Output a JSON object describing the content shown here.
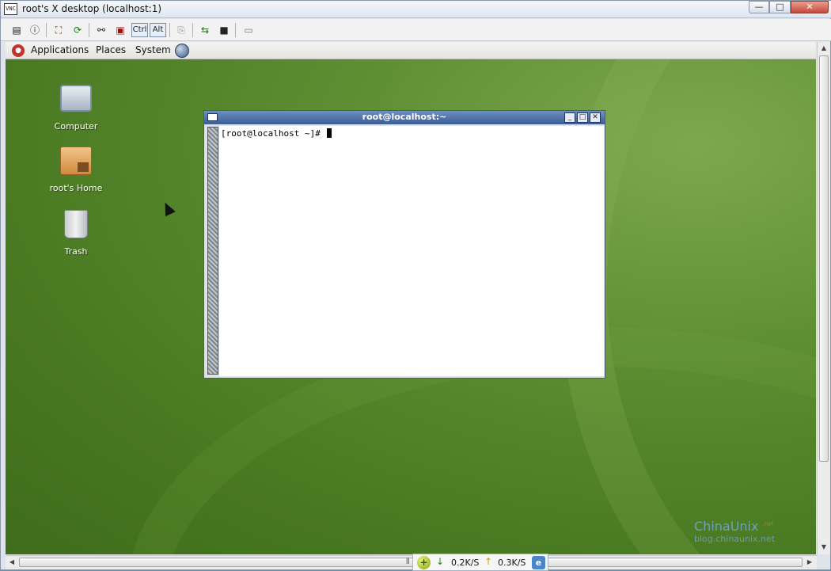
{
  "window": {
    "title": "root's X desktop (localhost:1)",
    "icon_text": "VNC",
    "controls": {
      "minimize": "—",
      "maximize": "□",
      "close": "✕"
    }
  },
  "toolbar": {
    "ctrl_label": "Ctrl",
    "alt_label": "Alt",
    "icons": [
      "connection-options-icon",
      "connection-info-icon",
      "full-screen-icon",
      "refresh-icon",
      "ctrl-alt-del-icon",
      "send-ctrl-esc-icon",
      "ctrl-key-icon",
      "alt-key-icon",
      "clipboard-icon",
      "transfer-files-icon",
      "save-icon",
      "close-connection-icon"
    ]
  },
  "panel": {
    "menus": [
      "Applications",
      "Places",
      "System"
    ]
  },
  "desktop_icons": [
    {
      "label": "Computer",
      "icon": "computer-icon"
    },
    {
      "label": "root's Home",
      "icon": "home-folder-icon"
    },
    {
      "label": "Trash",
      "icon": "trash-icon"
    }
  ],
  "terminal": {
    "title": "root@localhost:~",
    "prompt": "[root@localhost ~]# "
  },
  "watermark": {
    "main": "ChinaUnix",
    "sup": ".net",
    "sub": "blog.chinaunix.net"
  },
  "netmeter": {
    "down": "0.2K/S",
    "up": "0.3K/S"
  },
  "colors": {
    "desktop_green": "#5f8f33",
    "terminal_title_blue": "#3a5c98"
  }
}
